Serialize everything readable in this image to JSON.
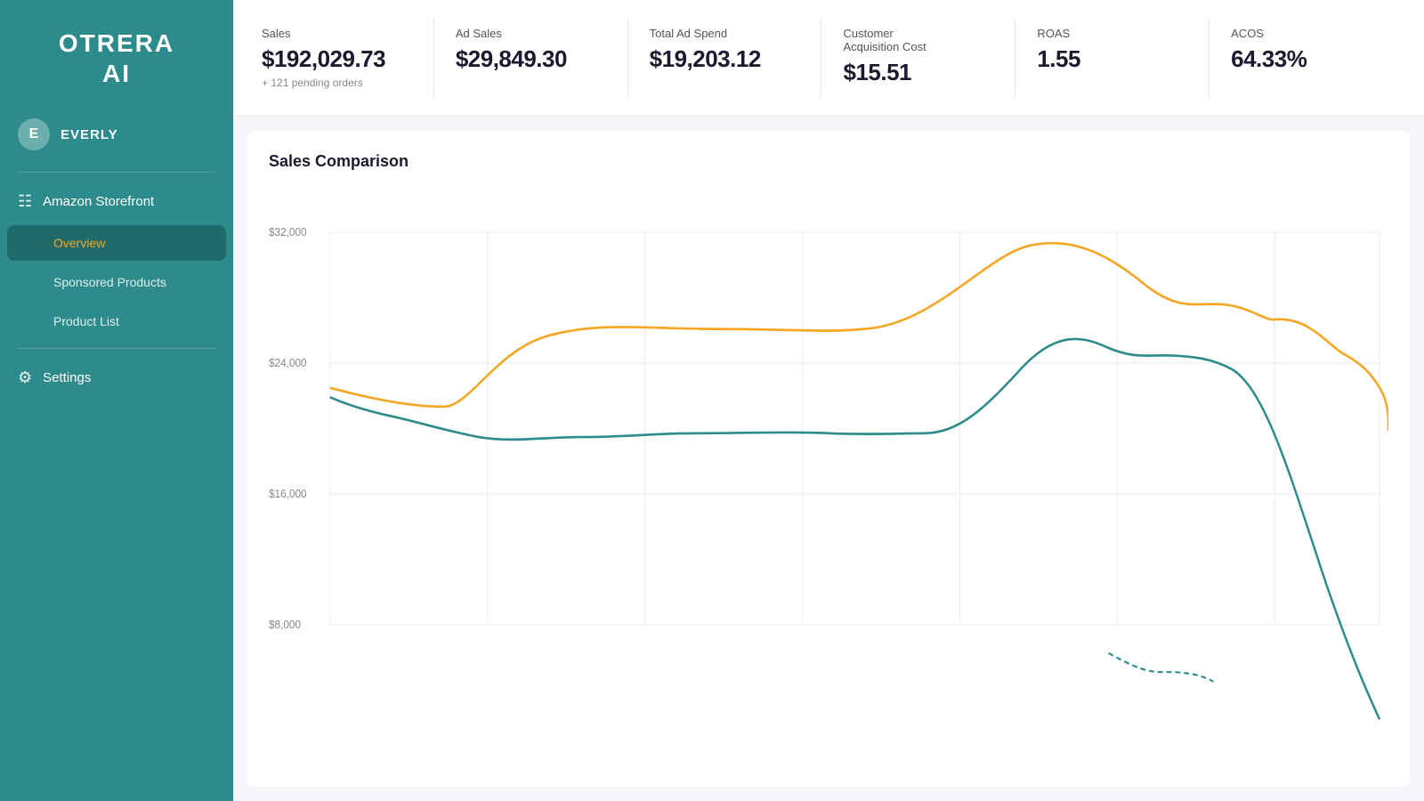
{
  "logo": {
    "line1": "OTRERA",
    "line2": "AI"
  },
  "user": {
    "initial": "E",
    "name": "EVERLY"
  },
  "sidebar": {
    "amazon_storefront_label": "Amazon Storefront",
    "overview_label": "Overview",
    "sponsored_products_label": "Sponsored Products",
    "product_list_label": "Product List",
    "settings_label": "Settings"
  },
  "kpis": [
    {
      "label": "Sales",
      "value": "$192,029.73",
      "sub": "+ 121 pending orders"
    },
    {
      "label": "Ad Sales",
      "value": "$29,849.30",
      "sub": ""
    },
    {
      "label": "Total Ad Spend",
      "value": "$19,203.12",
      "sub": ""
    },
    {
      "label": "Customer Acquisition Cost",
      "value": "$15.51",
      "sub": ""
    },
    {
      "label": "ROAS",
      "value": "1.55",
      "sub": ""
    },
    {
      "label": "ACOS",
      "value": "64.33%",
      "sub": ""
    }
  ],
  "chart": {
    "title": "Sales Comparison",
    "y_labels": [
      "$32,000",
      "$24,000",
      "$16,000",
      "$8,000"
    ]
  }
}
